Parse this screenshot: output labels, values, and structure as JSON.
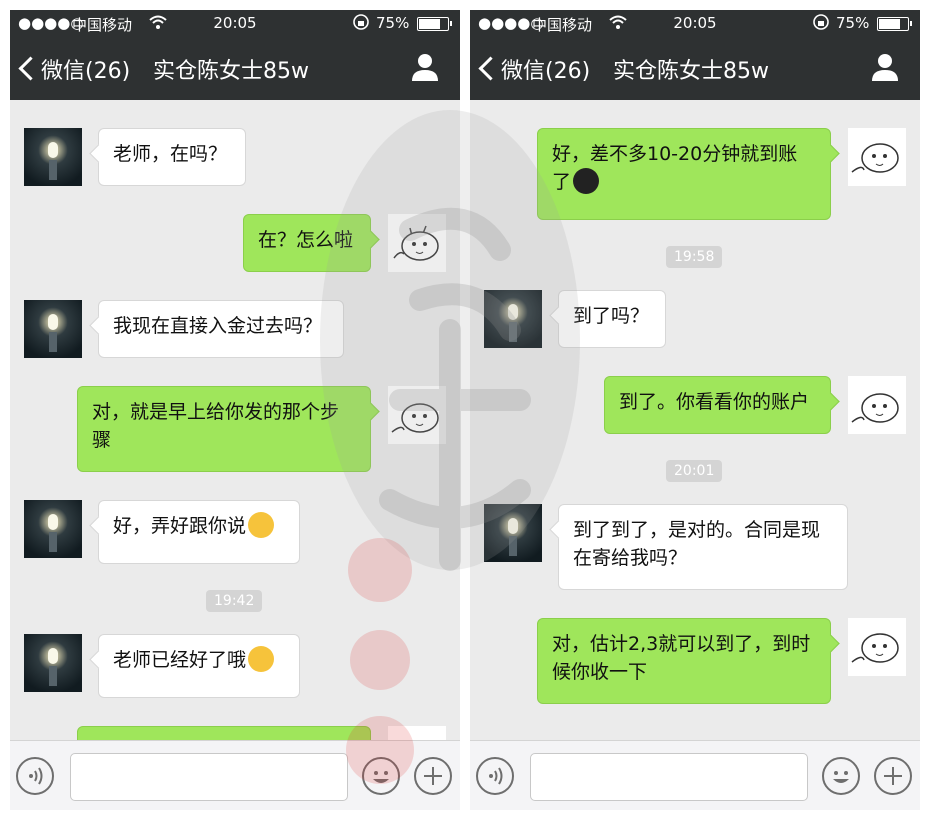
{
  "status_bar": {
    "signal": "●●●●○",
    "carrier": "中国移动",
    "time": "20:05",
    "battery": "75%",
    "battery_fraction": 0.75
  },
  "nav": {
    "back_label": "微信(26)",
    "title": "实仓陈女士85w"
  },
  "left_messages": [
    {
      "from": "contact",
      "text": "老师，在吗？"
    },
    {
      "from": "me",
      "text": "在？怎么啦"
    },
    {
      "from": "contact",
      "text": "我现在直接入金过去吗？"
    },
    {
      "from": "me",
      "text": "对，就是早上给你发的那个步骤"
    },
    {
      "from": "contact",
      "text": "好，弄好跟你说",
      "emoji": "shy-emoji"
    },
    {
      "timestamp": "19:42"
    },
    {
      "from": "contact",
      "text": "老师已经好了哦",
      "emoji": "grin-emoji"
    }
  ],
  "right_messages": [
    {
      "from": "me",
      "text": "好，差不多10-20分钟就到账了",
      "emoji": "qq-penguin-emoji"
    },
    {
      "timestamp": "19:58"
    },
    {
      "from": "contact",
      "text": "到了吗？"
    },
    {
      "from": "me",
      "text": "到了。你看看你的账户"
    },
    {
      "timestamp": "20:01"
    },
    {
      "from": "contact",
      "text": "到了到了，是对的。合同是现在寄给我吗？"
    },
    {
      "from": "me",
      "text": "对，估计2,3就可以到了，到时候你收一下"
    }
  ],
  "input_bar": {
    "placeholder": "",
    "icons": [
      "voice-icon",
      "emoji-icon",
      "plus-icon"
    ]
  },
  "colors": {
    "header": "#2e3132",
    "chat_bg": "#ebebeb",
    "outgoing_bubble": "#9fe65b",
    "incoming_bubble": "#ffffff"
  }
}
